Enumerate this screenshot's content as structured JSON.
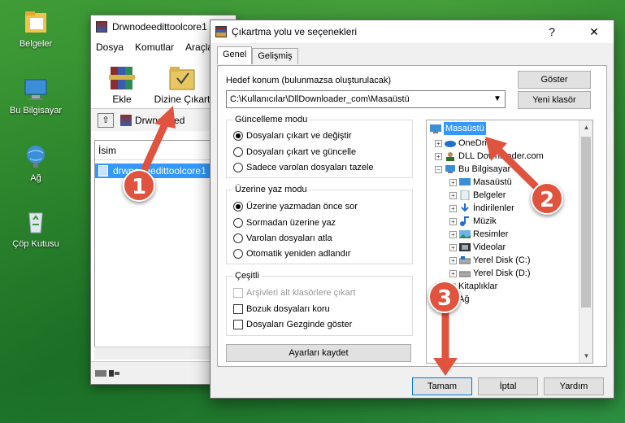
{
  "desktop": {
    "icons": [
      {
        "label": "Belgeler"
      },
      {
        "label": "Bu Bilgisayar"
      },
      {
        "label": "Ağ"
      },
      {
        "label": "Çöp Kutusu"
      }
    ]
  },
  "winrar": {
    "title": "Drwnodeedittoolcore1",
    "menu": [
      "Dosya",
      "Komutlar",
      "Araçla"
    ],
    "toolbar": {
      "extract": "Ekle",
      "extract_to": "Dizine Çıkart"
    },
    "path": "Drwnodeed",
    "column_name": "İsim",
    "file_row": "drwnodeedittoolcore1"
  },
  "dialog": {
    "title": "Çıkartma yolu ve seçenekleri",
    "help": "?",
    "close": "✕",
    "tabs": [
      "Genel",
      "Gelişmiş"
    ],
    "destination_label": "Hedef konum (bulunmazsa oluşturulacak)",
    "destination_value": "C:\\Kullanıcılar\\DllDownloader_com\\Masaüstü",
    "show_button": "Göster",
    "new_folder_button": "Yeni klasör",
    "update_mode": {
      "title": "Güncelleme modu",
      "options": [
        "Dosyaları çıkart ve değiştir",
        "Dosyaları çıkart ve güncelle",
        "Sadece varolan dosyaları tazele"
      ],
      "selected": 0
    },
    "overwrite_mode": {
      "title": "Üzerine yaz modu",
      "options": [
        "Üzerine yazmadan önce sor",
        "Sormadan üzerine yaz",
        "Varolan dosyaları atla",
        "Otomatik yeniden adlandır"
      ],
      "selected": 0
    },
    "misc": {
      "title": "Çeşitli",
      "options": [
        "Arşivleri alt klasörlere çıkart",
        "Bozuk dosyaları koru",
        "Dosyaları Gezginde göster"
      ]
    },
    "save_settings": "Ayarları kaydet",
    "tree": [
      "Masaüstü",
      "OneDrive",
      "DLL Downloader.com",
      "Bu Bilgisayar",
      "Masaüstü",
      "Belgeler",
      "İndirilenler",
      "Müzik",
      "Resimler",
      "Videolar",
      "Yerel Disk (C:)",
      "Yerel Disk (D:)",
      "Kitaplıklar",
      "Ağ"
    ],
    "ok": "Tamam",
    "cancel": "İptal",
    "help_button": "Yardım"
  },
  "annotations": [
    "1",
    "2",
    "3"
  ],
  "colors": {
    "arrow": "#e0533f",
    "selection": "#3399ff"
  }
}
